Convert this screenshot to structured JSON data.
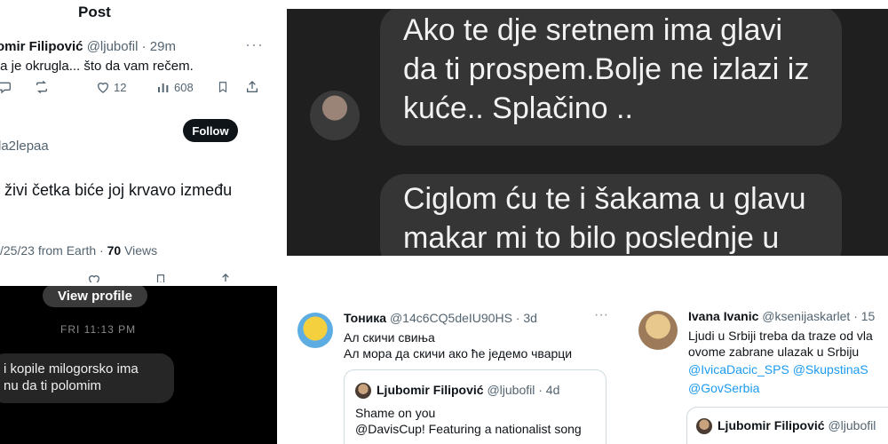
{
  "panelA": {
    "title": "Post",
    "author_name": "omir Filipović",
    "author_handle": "@ljubofil · 29m",
    "text1": "ta je okrugla... što da vam rečem.",
    "replies": "",
    "likes": "12",
    "views": "608",
    "follow_label": "Follow",
    "handle2": "la2lepaa",
    "text2": "i živi četka biće joj krvavo između",
    "meta_date": "/25/23 from Earth · ",
    "meta_views_count": "70",
    "meta_views_label": " Views"
  },
  "panelB": {
    "bubble1": "Ako te dje sretnem ima glavi da ti prospem.Bolje ne izlazi iz kuće.. Splačino ..",
    "bubble2": "Ciglom ću te i šakama u glavu makar mi to bilo poslednje u"
  },
  "panelC": {
    "view_profile": "View profile",
    "time": "FRI 11:13 PM",
    "message_line1": "i kopile milogorsko ima",
    "message_line2": "nu da ti polomim"
  },
  "panelD": {
    "name": "Тоника",
    "handle": "@14c6CQ5deIU90HS · 3d",
    "line1": "Ал скичи свиња",
    "line2": "Ал мора да скичи ако ће једемо чварци",
    "quote_name": "Ljubomir Filipović",
    "quote_handle": "@ljubofil · 4d",
    "quote_line1": "Shame on you",
    "quote_line2": "@DavisCup! Featuring a nationalist song"
  },
  "panelE": {
    "name": "Ivana Ivanic",
    "handle": "@ksenijaskarlet · 15",
    "line1": "Ljudi u Srbiji treba da traze od vla",
    "line2": "ovome  zabrane ulazak u Srbiju",
    "mention1": "@IvicaDacic_SPS",
    "mention2": "@SkupstinaS",
    "mention3": "@GovSerbia",
    "quote_name": "Ljubomir Filipović",
    "quote_handle": "@ljubofil"
  },
  "icons": [
    "more-icon",
    "reply-icon",
    "retweet-icon",
    "like-icon",
    "views-icon",
    "bookmark-icon",
    "share-icon"
  ],
  "colors": {
    "x_link": "#1d9bf0",
    "dark_chat_bg": "#1f1f1f",
    "dark_bubble": "#353535",
    "follow_bg": "#0f1419"
  }
}
